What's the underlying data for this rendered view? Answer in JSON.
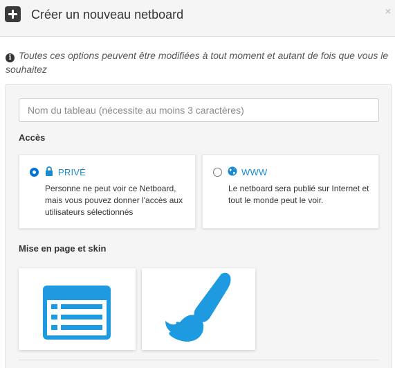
{
  "header": {
    "title": "Créer un nouveau netboard",
    "close_label": "×"
  },
  "info": {
    "text": "Toutes ces options peuvent être modifiées à tout moment et autant de fois que vous le souhaitez"
  },
  "form": {
    "name_placeholder": "Nom du tableau (nécessite au moins 3 caractères)",
    "name_value": "",
    "access_label": "Accès",
    "layout_label": "Mise en page et skin"
  },
  "access_options": [
    {
      "id": "private",
      "title": "PRIVÉ",
      "icon": "lock-icon",
      "checked": true,
      "description": "Personne ne peut voir ce Netboard, mais vous pouvez donner l'accès aux utilisateurs sélectionnés"
    },
    {
      "id": "www",
      "title": "WWW",
      "icon": "globe-icon",
      "checked": false,
      "description": "Le netboard sera publié sur Internet et tout le monde peut le voir."
    }
  ],
  "skins": [
    {
      "id": "list-layout",
      "icon": "list-layout-icon"
    },
    {
      "id": "brush-skin",
      "icon": "paintbrush-icon"
    }
  ],
  "colors": {
    "accent": "#1e9be0",
    "link": "#1a8ad0",
    "radio_checked": "#0075d8"
  }
}
